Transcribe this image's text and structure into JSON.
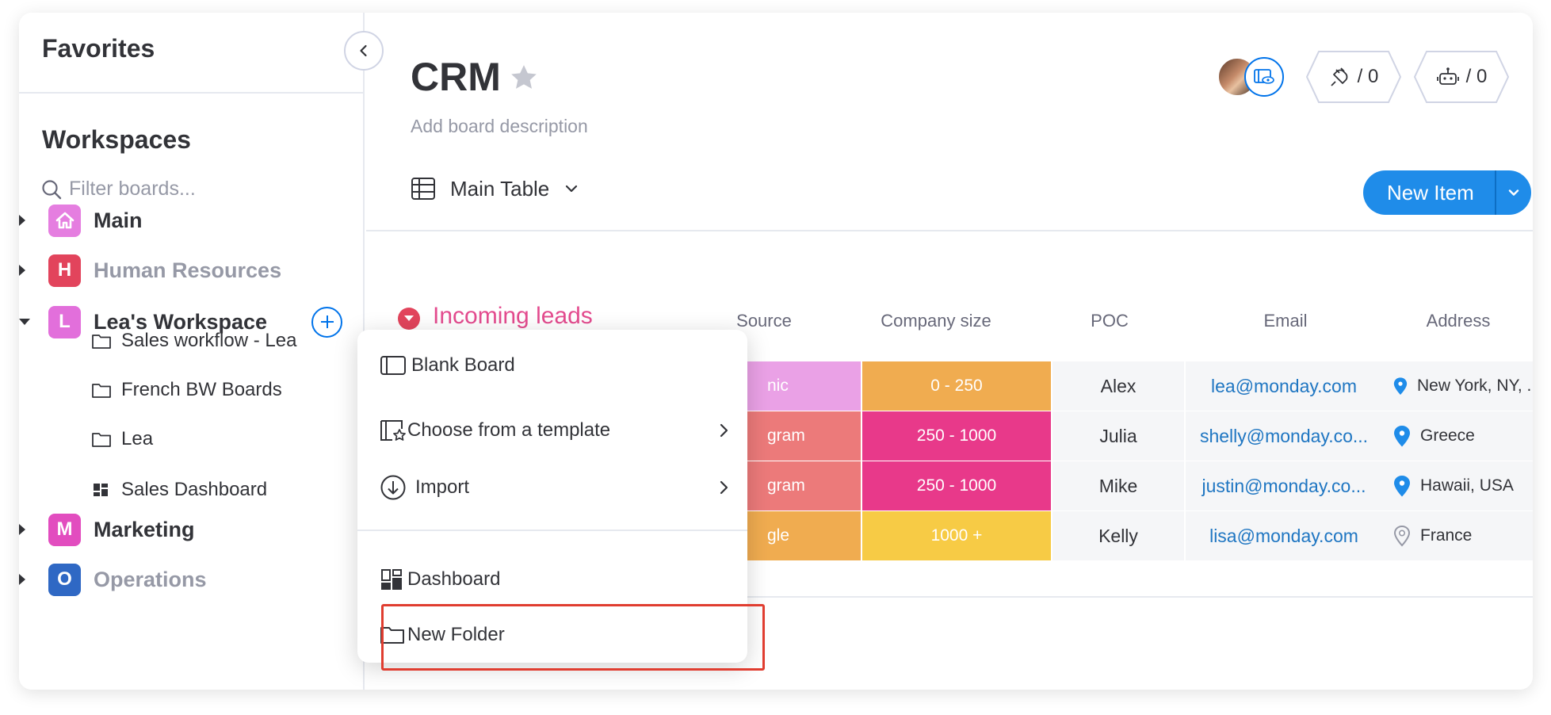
{
  "sidebar": {
    "favorites_title": "Favorites",
    "workspaces_title": "Workspaces",
    "filter_placeholder": "Filter boards...",
    "workspaces": [
      {
        "letter": "",
        "label": "Main",
        "color": "#e57ee0",
        "label_color": "#323338"
      },
      {
        "letter": "H",
        "label": "Human Resources",
        "color": "#e2445c",
        "label_color": "#9699a6"
      },
      {
        "letter": "L",
        "label": "Lea's Workspace",
        "color": "#e26fdb",
        "label_color": "#323338"
      },
      {
        "letter": "M",
        "label": "Marketing",
        "color": "#e24dbf",
        "label_color": "#323338"
      },
      {
        "letter": "O",
        "label": "Operations",
        "color": "#2f68c4",
        "label_color": "#9699a6"
      }
    ],
    "lea_items": [
      {
        "label": "Sales workflow - Lea",
        "icon": "folder-icon"
      },
      {
        "label": "French BW Boards",
        "icon": "folder-icon"
      },
      {
        "label": "Lea",
        "icon": "folder-icon"
      },
      {
        "label": "Sales Dashboard",
        "icon": "dashboard-icon"
      }
    ]
  },
  "board": {
    "title": "CRM",
    "description": "Add board description",
    "integrations_count": "/ 0",
    "automations_count": "/ 0",
    "view_label": "Main Table",
    "new_item_label": "New Item"
  },
  "group": {
    "title": "Incoming leads",
    "color": "#e44c8f"
  },
  "columns": [
    "Source",
    "Company size",
    "POC",
    "Email",
    "Address"
  ],
  "rows": [
    {
      "source": "nic",
      "source_color": "#eaa1e6",
      "size": "0 - 250",
      "size_color": "#f0ac50",
      "poc": "Alex",
      "email": "lea@monday.com",
      "address": "New York, NY, ...",
      "pin": "blue"
    },
    {
      "source": "gram",
      "source_color": "#ec7a7a",
      "size": "250 - 1000",
      "size_color": "#e8398a",
      "poc": "Julia",
      "email": "shelly@monday.co...",
      "address": "Greece",
      "pin": "blue"
    },
    {
      "source": "gram",
      "source_color": "#ec7a7a",
      "size": "250 - 1000",
      "size_color": "#e8398a",
      "poc": "Mike",
      "email": "justin@monday.co...",
      "address": "Hawaii, USA",
      "pin": "blue"
    },
    {
      "source": "gle",
      "source_color": "#f0ac50",
      "size": "1000 +",
      "size_color": "#f7cb45",
      "poc": "Kelly",
      "email": "lisa@monday.com",
      "address": "France",
      "pin": "gray"
    }
  ],
  "menu": {
    "blank_board": "Blank Board",
    "template": "Choose from a template",
    "import": "Import",
    "dashboard": "Dashboard",
    "new_folder": "New Folder"
  }
}
